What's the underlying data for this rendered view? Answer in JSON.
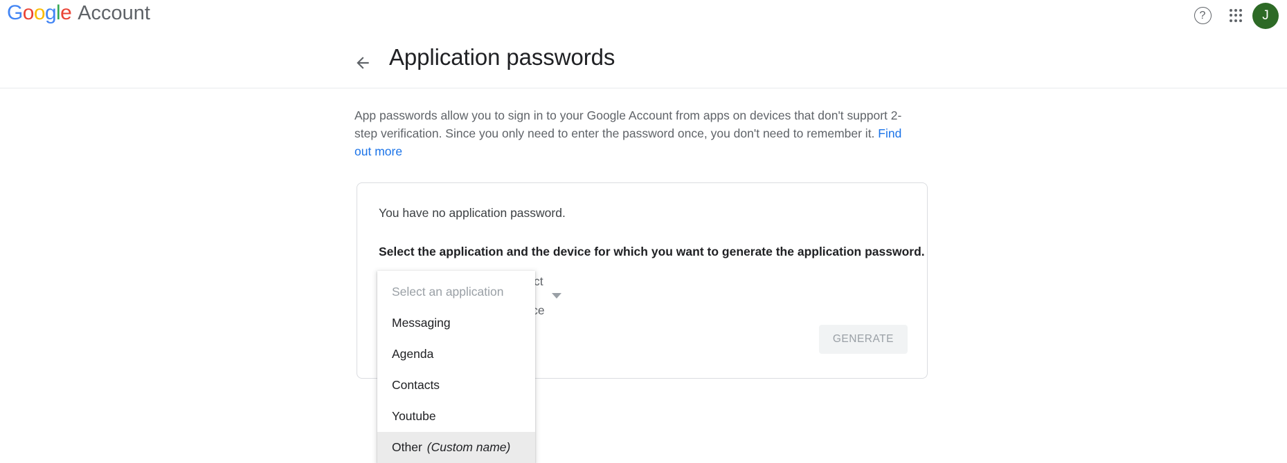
{
  "header": {
    "logo_text": "Google",
    "logo_letters": [
      "G",
      "o",
      "o",
      "g",
      "l",
      "e"
    ],
    "product_name": "Account",
    "help_icon_label": "?",
    "apps_icon_name": "apps-grid-icon",
    "avatar_initial": "J",
    "avatar_color": "#2d6a26",
    "brand_colors": {
      "blue": "#4285f4",
      "red": "#ea4335",
      "yellow": "#fbbc05",
      "green": "#34a853"
    }
  },
  "page": {
    "title": "Application passwords",
    "back_icon": "arrow-left-icon"
  },
  "description": {
    "text_part_1": "App passwords allow you to sign in to your Google Account from apps on devices that don't support 2-step verification. Since you only need to enter the password once, you don't need to remember it. ",
    "link_text": "Find out more",
    "link_color": "#1a73e8"
  },
  "card": {
    "no_password_text": "You have no application password.",
    "instruction_text": "Select the application and the device for which you want to generate the application password.",
    "application_select": {
      "value": "Select an application",
      "is_placeholder": true,
      "expanded": true
    },
    "device_select": {
      "value": "Select a device",
      "is_placeholder": true,
      "expanded": false
    },
    "generate_button": {
      "label": "GENERATE",
      "disabled": true
    }
  },
  "application_dropdown": {
    "options": [
      {
        "label": "Select an application",
        "suffix": "",
        "placeholder": true,
        "highlighted": false
      },
      {
        "label": "Messaging",
        "suffix": "",
        "placeholder": false,
        "highlighted": false
      },
      {
        "label": "Agenda",
        "suffix": "",
        "placeholder": false,
        "highlighted": false
      },
      {
        "label": "Contacts",
        "suffix": "",
        "placeholder": false,
        "highlighted": false
      },
      {
        "label": "Youtube",
        "suffix": "",
        "placeholder": false,
        "highlighted": false
      },
      {
        "label": "Other",
        "suffix": "(Custom name)",
        "placeholder": false,
        "highlighted": true
      }
    ]
  }
}
